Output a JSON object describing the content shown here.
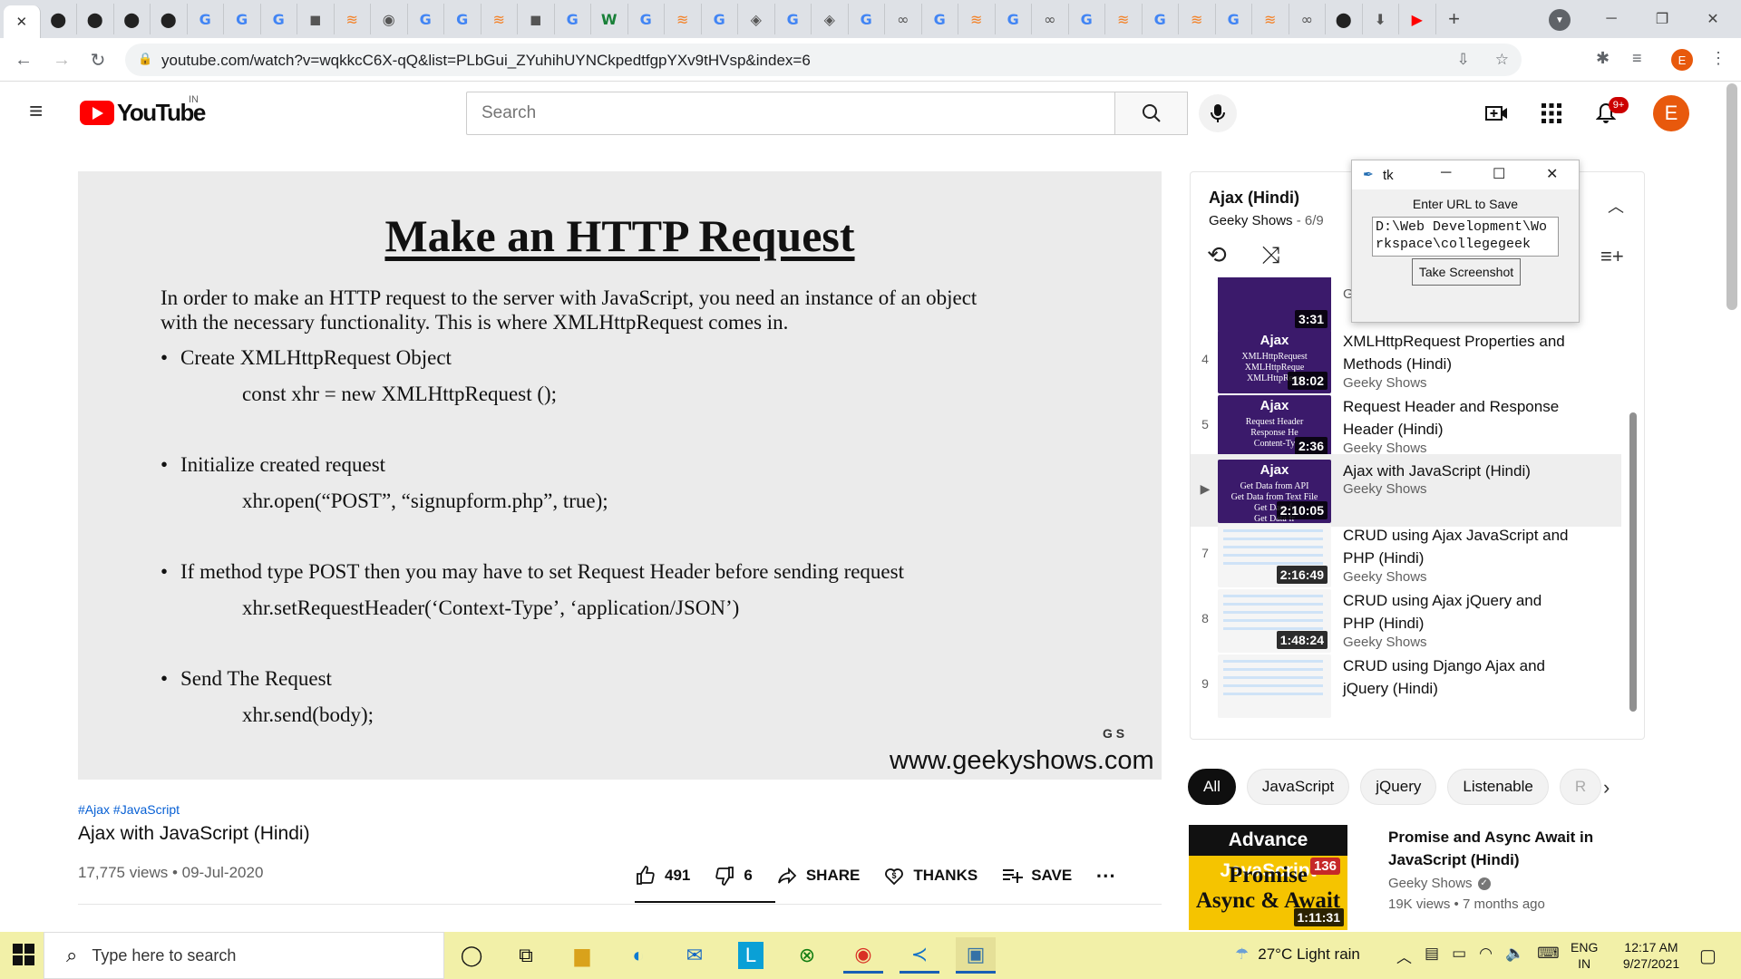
{
  "browser": {
    "tabs": [
      {
        "icon": "close-icon",
        "glyph": "✕"
      },
      {
        "icon": "github-icon",
        "glyph": "⬤"
      },
      {
        "icon": "github-icon",
        "glyph": "⬤"
      },
      {
        "icon": "github-icon",
        "glyph": "⬤"
      },
      {
        "icon": "github-icon",
        "glyph": "⬤"
      },
      {
        "icon": "google-icon",
        "glyph": "G"
      },
      {
        "icon": "google-icon",
        "glyph": "G"
      },
      {
        "icon": "google-icon",
        "glyph": "G"
      },
      {
        "icon": "notion-icon",
        "glyph": "◼"
      },
      {
        "icon": "stackoverflow-icon",
        "glyph": "≋"
      },
      {
        "icon": "globe-icon",
        "glyph": "◉"
      },
      {
        "icon": "google-icon",
        "glyph": "G"
      },
      {
        "icon": "google-icon",
        "glyph": "G"
      },
      {
        "icon": "stackoverflow-icon",
        "glyph": "≋"
      },
      {
        "icon": "notion-icon",
        "glyph": "◼"
      },
      {
        "icon": "google-icon",
        "glyph": "G"
      },
      {
        "icon": "w-icon",
        "glyph": "W"
      },
      {
        "icon": "google-icon",
        "glyph": "G"
      },
      {
        "icon": "stackoverflow-icon",
        "glyph": "≋"
      },
      {
        "icon": "google-icon",
        "glyph": "G"
      },
      {
        "icon": "diamond-icon",
        "glyph": "◈"
      },
      {
        "icon": "google-icon",
        "glyph": "G"
      },
      {
        "icon": "diamond-icon",
        "glyph": "◈"
      },
      {
        "icon": "google-icon",
        "glyph": "G"
      },
      {
        "icon": "infinity-icon",
        "glyph": "∞"
      },
      {
        "icon": "google-icon",
        "glyph": "G"
      },
      {
        "icon": "stackoverflow-icon",
        "glyph": "≋"
      },
      {
        "icon": "google-icon",
        "glyph": "G"
      },
      {
        "icon": "infinity-icon",
        "glyph": "∞"
      },
      {
        "icon": "google-icon",
        "glyph": "G"
      },
      {
        "icon": "stackoverflow-icon",
        "glyph": "≋"
      },
      {
        "icon": "google-icon",
        "glyph": "G"
      },
      {
        "icon": "stackoverflow-icon",
        "glyph": "≋"
      },
      {
        "icon": "google-icon",
        "glyph": "G"
      },
      {
        "icon": "stackoverflow-icon",
        "glyph": "≋"
      },
      {
        "icon": "infinity-icon",
        "glyph": "∞"
      },
      {
        "icon": "github-icon",
        "glyph": "⬤"
      },
      {
        "icon": "download-icon",
        "glyph": "⬇"
      },
      {
        "icon": "youtube-icon",
        "glyph": "▶"
      }
    ],
    "url": "youtube.com/watch?v=wqkkcC6X-qQ&list=PLbGui_ZYuhihUYNCkpedtfgpYXv9tHVsp&index=6",
    "profile_initial": "E"
  },
  "youtube": {
    "logo_text": "YouTube",
    "country_code": "IN",
    "search_placeholder": "Search",
    "notification_count": "9+",
    "avatar_initial": "E"
  },
  "video": {
    "slide_title": "Make an HTTP Request",
    "intro_line1": "In order to make an HTTP request to the server with JavaScript, you need an instance of an object",
    "intro_line2": "with the necessary functionality. This is where XMLHttpRequest comes in.",
    "bullets": [
      {
        "heading": "Create XMLHttpRequest Object",
        "code": "const xhr = new XMLHttpRequest ();"
      },
      {
        "heading": "Initialize created request",
        "code": "xhr.open(“POST”, “signupform.php”, true);"
      },
      {
        "heading": "If method type POST then you may have to set Request Header before sending request",
        "code": "xhr.setRequestHeader(‘Context-Type’, ‘application/JSON’)"
      },
      {
        "heading": "Send The Request",
        "code": "xhr.send(body);"
      }
    ],
    "watermark": "www.geekyshows.com",
    "watermark_logo": "G S"
  },
  "info": {
    "hashtags": "#Ajax #JavaScript",
    "title": "Ajax with JavaScript (Hindi)",
    "meta": "17,775 views • 09-Jul-2020",
    "likes": "491",
    "dislikes": "6",
    "share": "SHARE",
    "thanks": "THANKS",
    "save": "SAVE"
  },
  "playlist": {
    "title": "Ajax (Hindi)",
    "channel": "Geeky Shows",
    "position": "6/9",
    "items": [
      {
        "index": "",
        "duration": "3:31",
        "title": "",
        "channel": "Ge",
        "thumb": "purple",
        "head": "",
        "lines": ""
      },
      {
        "index": "4",
        "duration": "18:02",
        "title": "XMLHttpRequest Properties and Methods (Hindi)",
        "channel": "Geeky Shows",
        "thumb": "purple",
        "head": "Ajax",
        "lines": "XMLHttpRequest\nXMLHttpReque\nXMLHttpRequ"
      },
      {
        "index": "5",
        "duration": "2:36",
        "title": "Request Header and Response Header (Hindi)",
        "channel": "Geeky Shows",
        "thumb": "purple",
        "head": "Ajax",
        "lines": "Request Header\nResponse He\nContent-Ty"
      },
      {
        "index": "▶",
        "duration": "2:10:05",
        "title": "Ajax with JavaScript (Hindi)",
        "channel": "Geeky Shows",
        "thumb": "purple",
        "head": "Ajax",
        "lines": "Get Data from API\nGet Data from Text File\nGet Data fr\nGet Data fr"
      },
      {
        "index": "7",
        "duration": "2:16:49",
        "title": "CRUD using Ajax JavaScript and PHP (Hindi)",
        "channel": "Geeky Shows",
        "thumb": "light",
        "head": "",
        "lines": ""
      },
      {
        "index": "8",
        "duration": "1:48:24",
        "title": "CRUD using Ajax jQuery and PHP (Hindi)",
        "channel": "Geeky Shows",
        "thumb": "light",
        "head": "",
        "lines": ""
      },
      {
        "index": "9",
        "duration": "",
        "title": "CRUD using Django Ajax and jQuery (Hindi)",
        "channel": "",
        "thumb": "light",
        "head": "",
        "lines": ""
      }
    ]
  },
  "tk_window": {
    "title": "tk",
    "label": "Enter URL to Save",
    "entry_value": "D:\\Web Development\\Workspace\\collegegeek",
    "button": "Take Screenshot"
  },
  "chips": [
    "All",
    "JavaScript",
    "jQuery",
    "Listenable",
    "R"
  ],
  "recommended": {
    "thumb_head": "Advance JavaScript",
    "thumb_body": "Promise\nAsync & Await",
    "thumb_badge": "136",
    "duration": "1:11:31",
    "title": "Promise and Async Await in JavaScript (Hindi)",
    "channel": "Geeky Shows",
    "meta": "19K views • 7 months ago"
  },
  "taskbar": {
    "search_placeholder": "Type here to search",
    "weather": "27°C  Light rain",
    "lang_line1": "ENG",
    "lang_line2": "IN",
    "time": "12:17 AM",
    "date": "9/27/2021"
  }
}
